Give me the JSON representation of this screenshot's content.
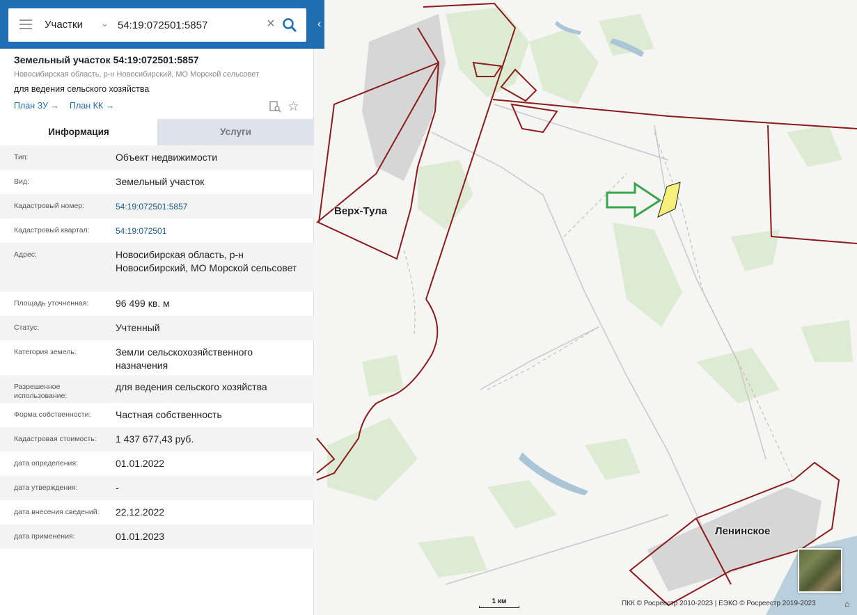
{
  "search": {
    "type_label": "Участки",
    "value": "54:19:072501:5857"
  },
  "parcel": {
    "title": "Земельный участок 54:19:072501:5857",
    "subtitle": "Новосибирская область, р-н Новосибирский, МО Морской сельсовет",
    "usage": "для ведения сельского хозяйства",
    "plan_zu": "План ЗУ →",
    "plan_kk": "План КК →"
  },
  "tabs": {
    "info": "Информация",
    "services": "Услуги"
  },
  "attributes": [
    {
      "label": "Тип:",
      "value": "Объект недвижимости"
    },
    {
      "label": "Вид:",
      "value": "Земельный участок"
    },
    {
      "label": "Кадастровый номер:",
      "value": "54:19:072501:5857",
      "link": true
    },
    {
      "label": "Кадастровый квартал:",
      "value": "54:19:072501",
      "link": true
    },
    {
      "label": "Адрес:",
      "value": "Новосибирская область, р-н Новосибирский, МО Морской сельсовет"
    },
    {
      "label": "Площадь уточненная:",
      "value": "96 499 кв. м"
    },
    {
      "label": "Статус:",
      "value": "Учтенный"
    },
    {
      "label": "Категория земель:",
      "value": "Земли сельскохозяйственного назначения"
    },
    {
      "label": "Разрешенное использование:",
      "value": "для ведения сельского хозяйства"
    },
    {
      "label": "Форма собственности:",
      "value": "Частная собственность"
    },
    {
      "label": "Кадастровая стоимость:",
      "value": "1 437 677,43 руб."
    },
    {
      "label": "дата определения:",
      "value": "01.01.2022"
    },
    {
      "label": "дата утверждения:",
      "value": "-"
    },
    {
      "label": "дата внесения сведений:",
      "value": "22.12.2022"
    },
    {
      "label": "дата применения:",
      "value": "01.01.2023"
    }
  ],
  "map": {
    "labels": {
      "verkh_tula": "Верх-Тула",
      "leninskoe": "Ленинское"
    },
    "scale": "1 км",
    "copyright": "ПКК © Росреестр 2010-2023 | ЕЭКО © Росреестр 2019-2023"
  },
  "colors": {
    "header": "#1f6db3",
    "boundary": "#8b1a1a",
    "parcel_fill": "#f5f07a",
    "arrow": "#3aa64a"
  }
}
